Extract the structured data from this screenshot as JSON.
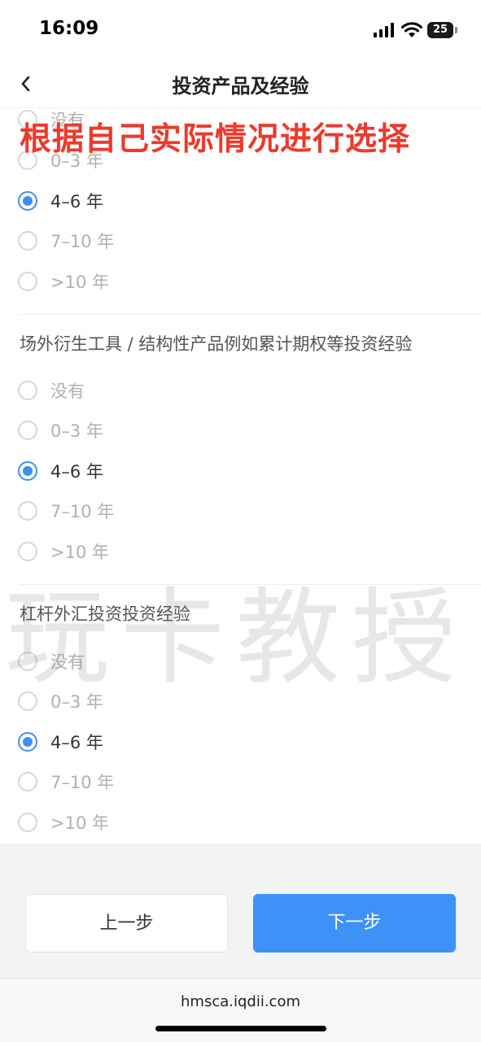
{
  "status_bar": {
    "time": "16:09",
    "battery": "25"
  },
  "header": {
    "title": "投资产品及经验"
  },
  "banner": "根据自己实际情况进行选择",
  "watermark": "玩卡教授",
  "partial_option": "没有",
  "sections": [
    {
      "question": "",
      "options": [
        {
          "label": "0–3 年",
          "selected": false
        },
        {
          "label": "4–6 年",
          "selected": true
        },
        {
          "label": "7–10 年",
          "selected": false
        },
        {
          "label": ">10 年",
          "selected": false
        }
      ]
    },
    {
      "question": "场外衍生工具 / 结构性产品例如累计期权等投资经验",
      "options": [
        {
          "label": "没有",
          "selected": false
        },
        {
          "label": "0–3 年",
          "selected": false
        },
        {
          "label": "4–6 年",
          "selected": true
        },
        {
          "label": "7–10 年",
          "selected": false
        },
        {
          "label": ">10 年",
          "selected": false
        }
      ]
    },
    {
      "question": "杠杆外汇投资投资经验",
      "options": [
        {
          "label": "没有",
          "selected": false
        },
        {
          "label": "0–3 年",
          "selected": false
        },
        {
          "label": "4–6 年",
          "selected": true
        },
        {
          "label": "7–10 年",
          "selected": false
        },
        {
          "label": ">10 年",
          "selected": false
        }
      ]
    }
  ],
  "footer": {
    "prev_label": "上一步",
    "next_label": "下一步"
  },
  "browser": {
    "url": "hmsca.iqdii.com"
  },
  "colors": {
    "accent": "#3d91f7",
    "banner": "#ec3a2c"
  }
}
